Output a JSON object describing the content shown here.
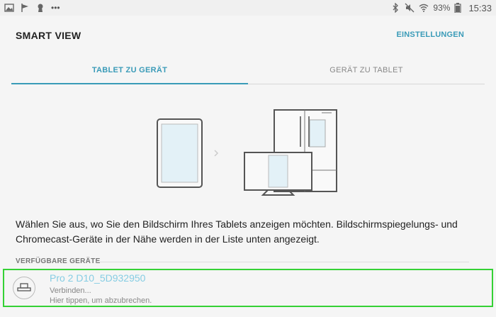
{
  "status_bar": {
    "left_icons": [
      "image-icon",
      "flag-icon",
      "keyhole-icon",
      "more-icon"
    ],
    "more_dots": "•••",
    "battery_percent": "93%",
    "time": "15:33"
  },
  "header": {
    "title": "SMART VIEW",
    "settings_label": "EINSTELLUNGEN"
  },
  "tabs": [
    {
      "label": "TABLET ZU GERÄT",
      "active": true
    },
    {
      "label": "GERÄT ZU TABLET",
      "active": false
    }
  ],
  "description": "Wählen Sie aus, wo Sie den Bildschirm Ihres Tablets anzeigen möchten. Bildschirmspiegelungs- und Chromecast-Geräte in der Nähe werden in der Liste unten angezeigt.",
  "available_devices": {
    "section_label": "VERFÜGBARE GERÄTE",
    "items": [
      {
        "name": "Pro 2 D10_5D932950",
        "status": "Verbinden...",
        "hint": "Hier tippen, um abzubrechen.",
        "icon": "projector-icon"
      }
    ]
  },
  "colors": {
    "accent": "#3a9bb8",
    "device_name": "#86cde3",
    "highlight": "#35d135"
  }
}
